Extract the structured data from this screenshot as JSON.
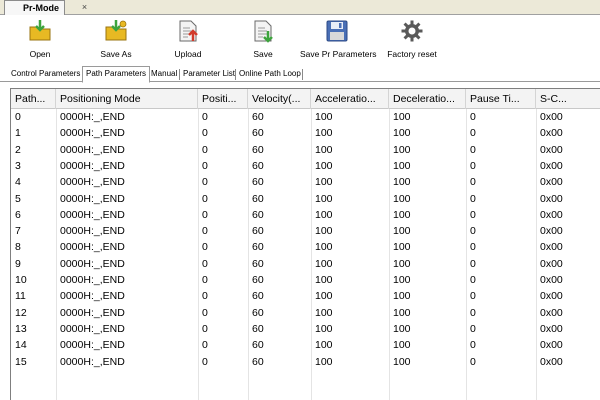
{
  "document_tab": {
    "title": "Pr-Mode",
    "close_glyph": "×"
  },
  "toolbar": [
    {
      "id": "open",
      "label": "Open",
      "icon": "folder-arrow-icon"
    },
    {
      "id": "save-as",
      "label": "Save As",
      "icon": "folder-save-as-icon"
    },
    {
      "id": "upload",
      "label": "Upload",
      "icon": "upload-document-icon"
    },
    {
      "id": "save",
      "label": "Save",
      "icon": "save-document-icon"
    },
    {
      "id": "save-pr",
      "label": "Save Pr Parameters",
      "icon": "floppy-disk-icon"
    },
    {
      "id": "factory-reset",
      "label": "Factory reset",
      "icon": "gear-reset-icon"
    }
  ],
  "subtabs": [
    {
      "label": "Control Parameters",
      "active": false
    },
    {
      "label": "Path Parameters",
      "active": true
    },
    {
      "label": "Manual",
      "active": false
    },
    {
      "label": "Parameter List",
      "active": false
    },
    {
      "label": "Online Path Loop",
      "active": false
    }
  ],
  "grid": {
    "columns": [
      "Path...",
      "Positioning Mode",
      "Positi...",
      "Velocity(...",
      "Acceleratio...",
      "Deceleratio...",
      "Pause Ti...",
      "S-C..."
    ],
    "rows": [
      [
        "0",
        "0000H:_,END",
        "0",
        "60",
        "100",
        "100",
        "0",
        "0x00"
      ],
      [
        "1",
        "0000H:_,END",
        "0",
        "60",
        "100",
        "100",
        "0",
        "0x00"
      ],
      [
        "2",
        "0000H:_,END",
        "0",
        "60",
        "100",
        "100",
        "0",
        "0x00"
      ],
      [
        "3",
        "0000H:_,END",
        "0",
        "60",
        "100",
        "100",
        "0",
        "0x00"
      ],
      [
        "4",
        "0000H:_,END",
        "0",
        "60",
        "100",
        "100",
        "0",
        "0x00"
      ],
      [
        "5",
        "0000H:_,END",
        "0",
        "60",
        "100",
        "100",
        "0",
        "0x00"
      ],
      [
        "6",
        "0000H:_,END",
        "0",
        "60",
        "100",
        "100",
        "0",
        "0x00"
      ],
      [
        "7",
        "0000H:_,END",
        "0",
        "60",
        "100",
        "100",
        "0",
        "0x00"
      ],
      [
        "8",
        "0000H:_,END",
        "0",
        "60",
        "100",
        "100",
        "0",
        "0x00"
      ],
      [
        "9",
        "0000H:_,END",
        "0",
        "60",
        "100",
        "100",
        "0",
        "0x00"
      ],
      [
        "10",
        "0000H:_,END",
        "0",
        "60",
        "100",
        "100",
        "0",
        "0x00"
      ],
      [
        "11",
        "0000H:_,END",
        "0",
        "60",
        "100",
        "100",
        "0",
        "0x00"
      ],
      [
        "12",
        "0000H:_,END",
        "0",
        "60",
        "100",
        "100",
        "0",
        "0x00"
      ],
      [
        "13",
        "0000H:_,END",
        "0",
        "60",
        "100",
        "100",
        "0",
        "0x00"
      ],
      [
        "14",
        "0000H:_,END",
        "0",
        "60",
        "100",
        "100",
        "0",
        "0x00"
      ],
      [
        "15",
        "0000H:_,END",
        "0",
        "60",
        "100",
        "100",
        "0",
        "0x00"
      ]
    ]
  },
  "colors": {
    "folder": "#e8b923",
    "arrow_green": "#3da43d",
    "arrow_red": "#d23a2a",
    "disk": "#4a6fb5",
    "gear": "#5a5a5a"
  }
}
